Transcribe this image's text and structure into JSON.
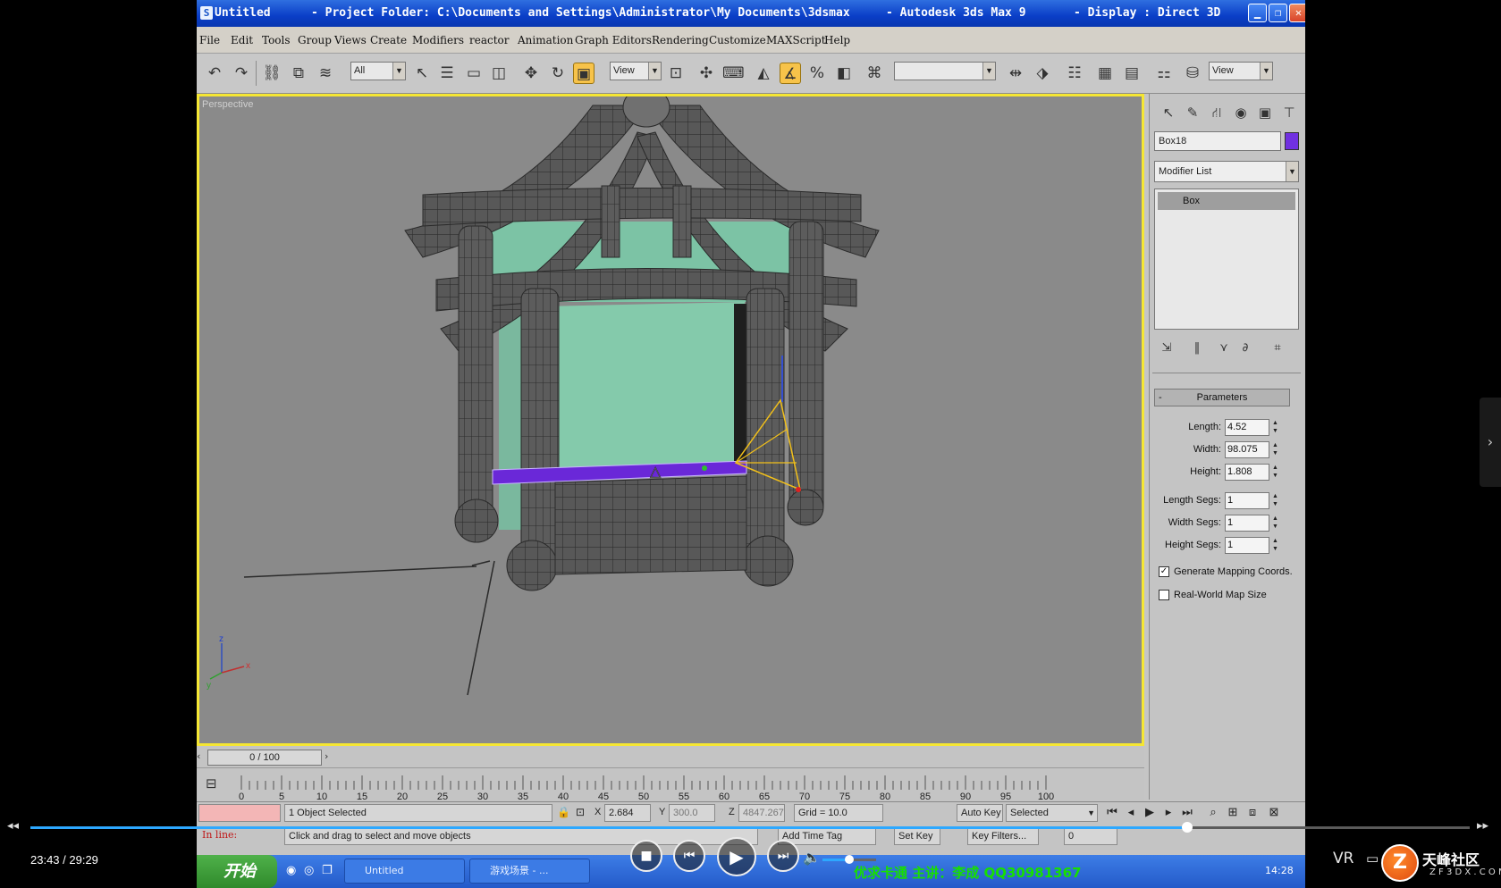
{
  "window": {
    "app_icon": "S",
    "title_part1": "Untitled",
    "title_part2": "- Project Folder: C:\\Documents and Settings\\Administrator\\My Documents\\3dsmax",
    "title_part3": "- Autodesk 3ds Max 9",
    "title_part4": "- Display : Direct 3D",
    "min_label": "▁",
    "max_label": "❐",
    "close_label": "✕"
  },
  "menu": [
    "File",
    "Edit",
    "Tools",
    "Group",
    "Views",
    "Create",
    "Modifiers",
    "reactor",
    "Animation",
    "Graph Editors",
    "Rendering",
    "Customize",
    "MAXScript",
    "Help"
  ],
  "toolbar": {
    "selection_filter": "All",
    "ref_coord": "View",
    "named_selection": "",
    "view_right": "View",
    "icons": [
      "undo-icon",
      "redo-icon",
      "select-link-icon",
      "unlink-icon",
      "bind-space-warp-icon",
      "select-object-icon",
      "select-by-name-icon",
      "rect-selection-icon",
      "window-crossing-icon",
      "move-icon",
      "rotate-icon",
      "scale-icon",
      "pivot-center-icon",
      "select-manipulate-icon",
      "keyboard-shortcut-icon",
      "snaps-toggle-icon",
      "angle-snap-icon",
      "percent-snap-icon",
      "spinner-snap-icon",
      "edit-named-selections-icon",
      "mirror-icon",
      "align-icon",
      "layer-manager-icon",
      "curve-editor-icon",
      "schematic-view-icon",
      "material-editor-icon",
      "render-scene-icon"
    ],
    "glyphs": [
      "↶",
      "↷",
      "⛓",
      "⧉",
      "≋",
      "↖",
      "☰",
      "▭",
      "◫",
      "✥",
      "↻",
      "▣",
      "⊡",
      "✣",
      "⌨",
      "◭",
      "∡",
      "%",
      "◧",
      "⌘",
      "⇹",
      "⬗",
      "☷",
      "▦",
      "▤",
      "⚏",
      "⛁"
    ]
  },
  "viewport": {
    "label": "Perspective",
    "accent_border": "#f5e633",
    "house_color": "#5b5b5b",
    "window_color": "#7cc3a5",
    "selected_color": "#6a28d8",
    "axis_labels": [
      "z",
      "x",
      "y"
    ]
  },
  "command_panel": {
    "tab_icons": [
      "create-tab-icon",
      "modify-tab-icon",
      "hierarchy-tab-icon",
      "motion-tab-icon",
      "display-tab-icon",
      "utilities-tab-icon"
    ],
    "tab_glyphs": [
      "↖",
      "✎",
      "⛙",
      "◉",
      "▣",
      "⊤"
    ],
    "object_name": "Box18",
    "object_color": "#7030e0",
    "modifier_list": "Modifier List",
    "stack_item": "Box",
    "stack_btn_glyphs": [
      "⇲",
      "‖",
      "⋎",
      "∂",
      "⌗"
    ],
    "parameters_title": "Parameters",
    "params": [
      {
        "label": "Length:",
        "value": "4.52"
      },
      {
        "label": "Width:",
        "value": "98.075"
      },
      {
        "label": "Height:",
        "value": "1.808"
      },
      {
        "label": "Length Segs:",
        "value": "1"
      },
      {
        "label": "Width Segs:",
        "value": "1"
      },
      {
        "label": "Height Segs:",
        "value": "1"
      }
    ],
    "checkboxes": [
      {
        "label": "Generate Mapping Coords.",
        "checked": "✓"
      },
      {
        "label": "Real-World Map Size",
        "checked": ""
      }
    ]
  },
  "timeline": {
    "frame_label": "0 / 100",
    "ticks": [
      "0",
      "5",
      "10",
      "15",
      "20",
      "25",
      "30",
      "35",
      "40",
      "45",
      "50",
      "55",
      "60",
      "65",
      "70",
      "75",
      "80",
      "85",
      "90",
      "95",
      "100"
    ]
  },
  "status": {
    "selection": "1 Object Selected",
    "prompt_label": "In line:",
    "prompt": "Click and drag to select and move objects",
    "x_label": "X",
    "x_value": "2.684",
    "y_label": "Y",
    "y_value": "300.0",
    "z_label": "Z",
    "z_value": "4847.267",
    "grid": "Grid = 10.0",
    "auto_key": "Auto Key",
    "selected_dropdown": "Selected",
    "set_key": "Set Key",
    "key_filters": "Key Filters...",
    "add_time_tag": "Add Time Tag",
    "frame_field": "0"
  },
  "taskbar": {
    "start": "开始",
    "tasks": [
      "Untitled",
      "游戏场景 - ..."
    ],
    "tray_text": "优求卡通 主讲：李成 QQ30981367",
    "clock": "14:28"
  },
  "player": {
    "time": "23:43 / 29:29",
    "progress": 0.804,
    "volume": 0.5,
    "vr_label": "VR",
    "skip_back": "◂◂",
    "skip_fwd": "▸▸",
    "stop_glyph": "■",
    "prev_glyph": "⏮",
    "play_glyph": "▶",
    "next_glyph": "⏭",
    "volume_glyph": "🔈",
    "side_glyph": "›",
    "watermark_title": "天峰社区",
    "watermark_sub": "Z F 3 D X . C O M",
    "watermark_logo": "Z"
  }
}
